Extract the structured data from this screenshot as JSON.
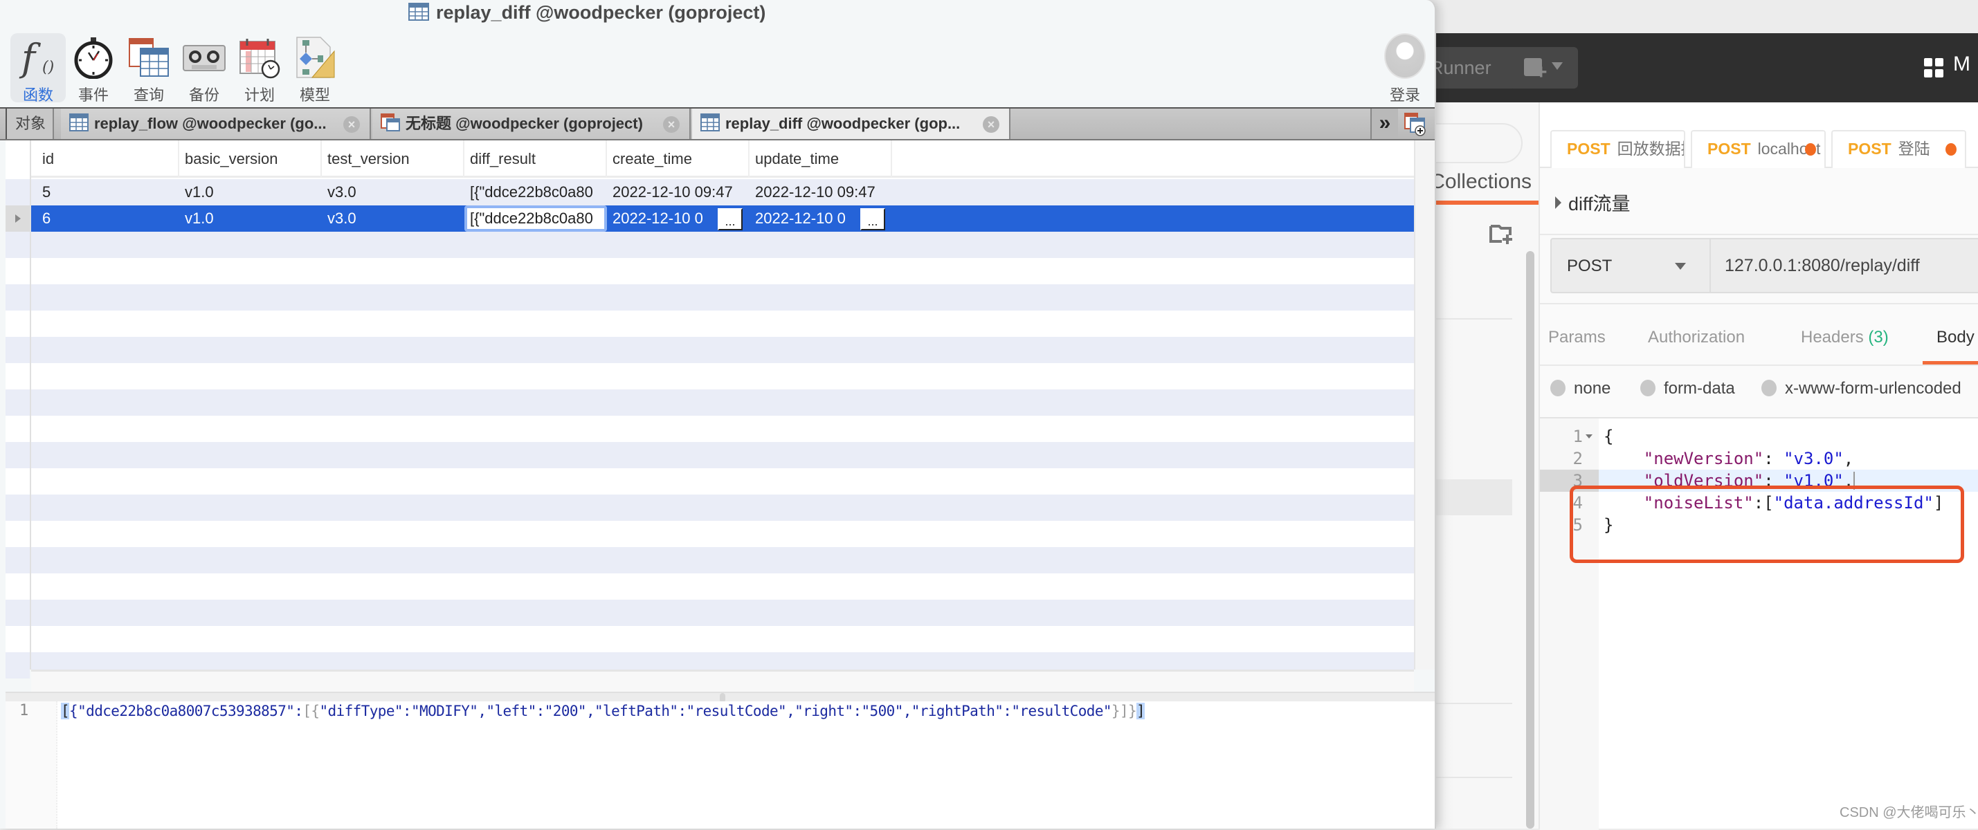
{
  "postman": {
    "header": {
      "runner_label": "Runner",
      "workspace_label": "M"
    },
    "sidebar": {
      "collections_tab": "Collections"
    },
    "tabs": [
      {
        "method": "POST",
        "name": "回放数据接口",
        "unsaved": false
      },
      {
        "method": "POST",
        "name": "localhost",
        "unsaved": true
      },
      {
        "method": "POST",
        "name": "登陆",
        "unsaved": true
      }
    ],
    "request_name": "diff流量",
    "method": "POST",
    "url": "127.0.0.1:8080/replay/diff",
    "request_tabs": {
      "params": "Params",
      "authorization": "Authorization",
      "headers": "Headers",
      "headers_count": "(3)",
      "body": "Body"
    },
    "body_types": [
      "none",
      "form-data",
      "x-www-form-urlencoded"
    ],
    "body_lines": [
      {
        "num": "1",
        "parts": [
          {
            "t": "{",
            "c": "p"
          }
        ]
      },
      {
        "num": "2",
        "parts": [
          {
            "t": "    ",
            "c": "p"
          },
          {
            "t": "\"newVersion\"",
            "c": "k"
          },
          {
            "t": ": ",
            "c": "p"
          },
          {
            "t": "\"v3.0\"",
            "c": "s"
          },
          {
            "t": ",",
            "c": "p"
          }
        ]
      },
      {
        "num": "3",
        "parts": [
          {
            "t": "    ",
            "c": "p"
          },
          {
            "t": "\"oldVersion\"",
            "c": "k"
          },
          {
            "t": ": ",
            "c": "p"
          },
          {
            "t": "\"v1.0\"",
            "c": "s"
          },
          {
            "t": ",",
            "c": "p"
          }
        ]
      },
      {
        "num": "4",
        "parts": [
          {
            "t": "    ",
            "c": "p"
          },
          {
            "t": "\"noiseList\"",
            "c": "k"
          },
          {
            "t": ":[",
            "c": "p"
          },
          {
            "t": "\"data.addressId\"",
            "c": "s"
          },
          {
            "t": "]",
            "c": "p"
          }
        ]
      },
      {
        "num": "5",
        "parts": [
          {
            "t": "}",
            "c": "p"
          }
        ]
      }
    ],
    "accent_color": "#f26b3a",
    "method_color": "#f5a623",
    "annotation_color": "#e8522a"
  },
  "navicat": {
    "window_title": "replay_diff @woodpecker (goproject)",
    "toolbar": [
      {
        "id": "function",
        "label": "函数",
        "icon": "function-icon",
        "active": true
      },
      {
        "id": "event",
        "label": "事件",
        "icon": "stopwatch-icon",
        "active": false
      },
      {
        "id": "query",
        "label": "查询",
        "icon": "query-table-icon",
        "active": false
      },
      {
        "id": "backup",
        "label": "备份",
        "icon": "cassette-icon",
        "active": false
      },
      {
        "id": "schedule",
        "label": "计划",
        "icon": "calendar-clock-icon",
        "active": false
      },
      {
        "id": "model",
        "label": "模型",
        "icon": "model-diagram-icon",
        "active": false
      }
    ],
    "login_label": "登录",
    "tabs": {
      "objects": "对象",
      "items": [
        {
          "label": "replay_flow @woodpecker (go...",
          "active": false
        },
        {
          "label": "无标题 @woodpecker (goproject)",
          "active": false
        },
        {
          "label": "replay_diff @woodpecker (gop...",
          "active": true
        }
      ],
      "more_label": "»"
    },
    "grid": {
      "columns": [
        "id",
        "basic_version",
        "test_version",
        "diff_result",
        "create_time",
        "update_time"
      ],
      "rows": [
        {
          "id": "5",
          "basic_version": "v1.0",
          "test_version": "v3.0",
          "diff_result": "[{\"ddce22b8c0a80",
          "create_time": "2022-12-10 09:47",
          "update_time": "2022-12-10 09:47",
          "selected": false
        },
        {
          "id": "6",
          "basic_version": "v1.0",
          "test_version": "v3.0",
          "diff_result": "[{\"ddce22b8c0a80",
          "create_time": "2022-12-10 0",
          "update_time": "2022-12-10 0",
          "selected": true
        }
      ],
      "ellipsis": "..."
    },
    "editor": {
      "line_number": "1",
      "value": "[{\"ddce22b8c0a8007c53938857\":[{\"diffType\":\"MODIFY\",\"left\":\"200\",\"leftPath\":\"resultCode\",\"right\":\"500\",\"rightPath\":\"resultCode\"}]}]"
    },
    "selection_color": "#2563d8",
    "stripe_color": "#eaedf7"
  },
  "watermark": "CSDN @大佬喝可乐丶"
}
